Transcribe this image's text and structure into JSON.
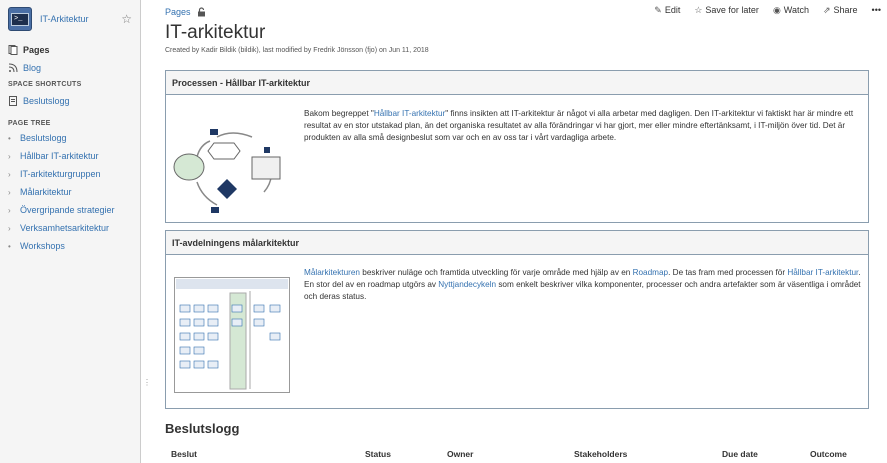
{
  "sidebar": {
    "space_name": "IT-Arkitektur",
    "space_logo_text": ">_",
    "nav": [
      {
        "label": "Pages"
      },
      {
        "label": "Blog"
      }
    ],
    "shortcuts_header": "SPACE SHORTCUTS",
    "shortcuts": [
      {
        "label": "Beslutslogg"
      }
    ],
    "tree_header": "PAGE TREE",
    "tree": [
      {
        "label": "Beslutslogg"
      },
      {
        "label": "Hållbar IT-arkitektur"
      },
      {
        "label": "IT-arkitekturgruppen"
      },
      {
        "label": "Målarkitektur"
      },
      {
        "label": "Övergripande strategier"
      },
      {
        "label": "Verksamhetsarkitektur"
      },
      {
        "label": "Workshops"
      }
    ]
  },
  "breadcrumb": "Pages",
  "actions": {
    "edit": "Edit",
    "save": "Save for later",
    "watch": "Watch",
    "share": "Share",
    "more": "•••"
  },
  "page": {
    "title": "IT-arkitektur",
    "byline": "Created by Kadir Bildik (bildik), last modified by Fredrik Jönsson (fjo) on Jun 11, 2018"
  },
  "panels": [
    {
      "title": "Processen - Hållbar IT-arkitektur",
      "text_before": "Bakom begreppet \"",
      "link": "Hållbar IT-arkitektur",
      "text_after": "\" finns insikten att IT-arkitektur är något vi alla arbetar med dagligen. Den IT-arkitektur vi faktiskt har är mindre ett resultat av en stor utstakad plan, än det organiska resultatet av alla förändringar vi har gjort, mer eller mindre eftertänksamt, i IT-miljön över tid. Det är produkten av alla små designbeslut som var och en av oss tar i vårt vardagliga arbete."
    },
    {
      "title": "IT-avdelningens målarkitektur",
      "link1": "Målarkitekturen",
      "t1": " beskriver nuläge och framtida utveckling för varje område med hjälp av en ",
      "link2": "Roadmap",
      "t2": ". De tas fram med processen för ",
      "link3": "Hållbar IT-arkitektur",
      "t3": ". En stor del av en roadmap utgörs av ",
      "link4": "Nyttjandecykeln",
      "t4": " som enkelt beskriver vilka komponenter, processer och andra artefakter som är väsentliga i området och deras status."
    }
  ],
  "decision_log": {
    "title": "Beslutslogg",
    "columns": [
      "Beslut",
      "Status",
      "Owner",
      "Stakeholders",
      "Due date",
      "Outcome"
    ]
  },
  "colors": {
    "link": "#3572b0",
    "sidebar_bg": "#f5f5f5",
    "panel_border": "#8a9dae",
    "diagram_navy": "#1f3864",
    "diagram_green": "#d5e8d4"
  },
  "icons": [
    "star-icon",
    "pages-icon",
    "blog-icon",
    "shortcut-page-icon",
    "lock-icon",
    "pencil-icon",
    "star-outline-icon",
    "eye-icon",
    "share-icon",
    "more-icon"
  ]
}
